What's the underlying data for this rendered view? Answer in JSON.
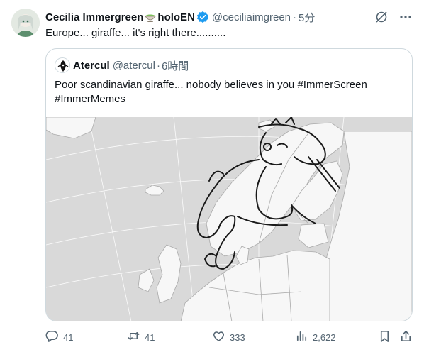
{
  "author": {
    "display_name": "Cecilia Immergreen",
    "name_suffix": "holoEN",
    "handle": "@ceciliaimgreen",
    "separator": "·",
    "time": "5分",
    "text": "Europe... giraffe... it's right there.........."
  },
  "quote": {
    "display_name": "Atercul",
    "handle": "@atercul",
    "separator": "·",
    "time": "6時間",
    "text_line1": "Poor scandinavian giraffe... nobody believes in you #ImmerScreen",
    "text_line2": "#ImmerMemes"
  },
  "actions": {
    "replies": "41",
    "reposts": "41",
    "likes": "333",
    "views": "2,622"
  },
  "colors": {
    "accent": "#1d9bf0",
    "text_primary": "#0f1419",
    "text_secondary": "#536471",
    "border": "#cfd9de",
    "map_sea": "#d9d9d9",
    "map_land": "#f7f7f7"
  },
  "icons": {
    "verified": "verified-badge-icon",
    "grok": "grok-icon",
    "more": "more-icon",
    "reply": "reply-icon",
    "repost": "repost-icon",
    "like": "like-icon",
    "views": "views-icon",
    "bookmark": "bookmark-icon",
    "share": "share-icon"
  }
}
